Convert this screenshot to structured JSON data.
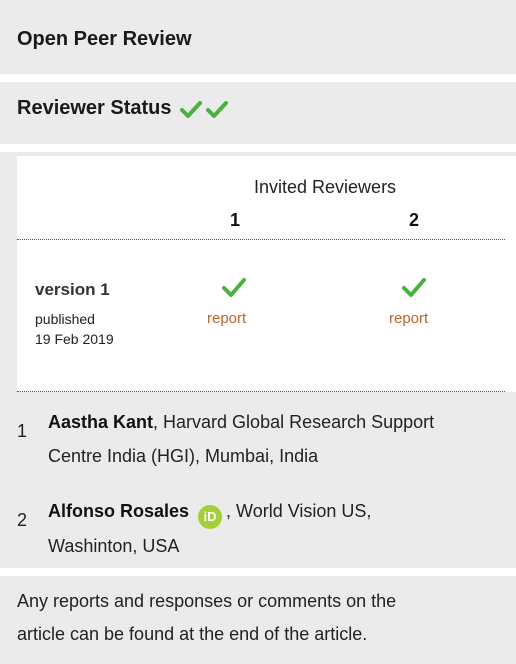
{
  "header": {
    "title": "Open Peer Review"
  },
  "status": {
    "label": "Reviewer Status",
    "checks": [
      "check-icon",
      "check-icon"
    ],
    "check_color": "#4cb040"
  },
  "table": {
    "invited_label": "Invited Reviewers",
    "columns": [
      "1",
      "2"
    ],
    "version": {
      "title": "version 1",
      "published_label": "published",
      "date": "19 Feb 2019",
      "reports": [
        "report",
        "report"
      ]
    },
    "link_color": "#c0622a"
  },
  "reviewers": [
    {
      "number": "1",
      "name": "Aastha Kant",
      "line1": ", Harvard Global Research Support",
      "line2": "Centre India (HGI), Mumbai, India"
    },
    {
      "number": "2",
      "name": "Alfonso Rosales",
      "orcid_label": "iD",
      "line1": ", World Vision US,",
      "line2": "Washinton, USA"
    }
  ],
  "note": {
    "line1": "Any reports and responses or comments on the",
    "line2": "article can be found at the end of the article."
  }
}
